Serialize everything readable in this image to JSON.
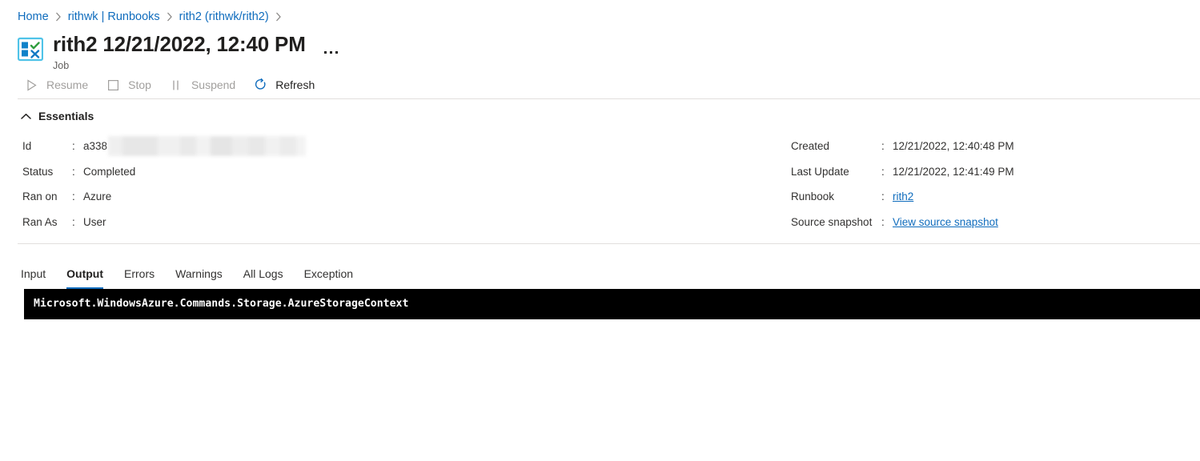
{
  "breadcrumb": {
    "items": [
      {
        "label": "Home"
      },
      {
        "label": "rithwk | Runbooks"
      },
      {
        "label": "rith2 (rithwk/rith2)"
      }
    ]
  },
  "header": {
    "title": "rith2 12/21/2022, 12:40 PM",
    "subtitle": "Job",
    "icon": "job-status-icon",
    "more_label": "More"
  },
  "command_bar": {
    "items": [
      {
        "label": "Resume",
        "icon": "play-icon",
        "enabled": false
      },
      {
        "label": "Stop",
        "icon": "stop-icon",
        "enabled": false
      },
      {
        "label": "Suspend",
        "icon": "pause-icon",
        "enabled": false
      },
      {
        "label": "Refresh",
        "icon": "refresh-icon",
        "enabled": true
      }
    ]
  },
  "essentials": {
    "label": "Essentials",
    "expanded": true,
    "left": [
      {
        "key": "Id",
        "value": "a338",
        "redacted": true
      },
      {
        "key": "Status",
        "value": "Completed"
      },
      {
        "key": "Ran on",
        "value": "Azure"
      },
      {
        "key": "Ran As",
        "value": "User"
      }
    ],
    "right": [
      {
        "key": "Created",
        "value": "12/21/2022, 12:40:48 PM"
      },
      {
        "key": "Last Update",
        "value": "12/21/2022, 12:41:49 PM"
      },
      {
        "key": "Runbook",
        "value": "rith2",
        "link": true
      },
      {
        "key": "Source snapshot",
        "value": "View source snapshot",
        "link": true
      }
    ]
  },
  "tabs": {
    "items": [
      {
        "label": "Input"
      },
      {
        "label": "Output"
      },
      {
        "label": "Errors"
      },
      {
        "label": "Warnings"
      },
      {
        "label": "All Logs"
      },
      {
        "label": "Exception"
      }
    ],
    "active": "Output"
  },
  "output": {
    "text": "Microsoft.WindowsAzure.Commands.Storage.AzureStorageContext"
  },
  "colors": {
    "link": "#0f6cbd",
    "accent": "#0f6cbd",
    "text": "#323130",
    "disabled": "#a19f9d",
    "divider": "#e1dfdd",
    "console_bg": "#000000",
    "icon_green": "#2e9e3e",
    "icon_blue": "#0f6cbd"
  }
}
